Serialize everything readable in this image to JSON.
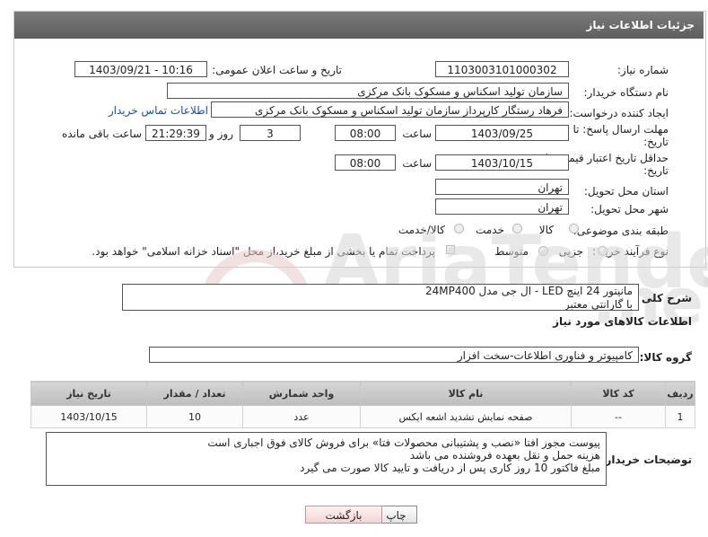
{
  "header": {
    "title": "جزئیات اطلاعات نیاز"
  },
  "form": {
    "need_number_label": "شماره نیاز:",
    "need_number": "1103003101000302",
    "announce_label": "تاریخ و ساعت اعلان عمومی:",
    "announce_value": "1403/09/21 - 10:16",
    "buyer_org_label": "نام دستگاه خریدار:",
    "buyer_org": "سازمان تولید اسکناس و مسکوک بانک مرکزی",
    "creator_label": "ایجاد کننده درخواست:",
    "creator": "فرهاد رستگار کارپرداز سازمان تولید اسکناس و مسکوک بانک مرکزی",
    "contact_link": "اطلاعات تماس خریدار",
    "deadline_label_1": "مهلت ارسال پاسخ: تا",
    "deadline_label_2": "تاریخ:",
    "deadline_date": "1403/09/25",
    "time_label": "ساعت",
    "deadline_time": "08:00",
    "days_value": "3",
    "days_label": "روز و",
    "remaining_time": "21:29:39",
    "remaining_label": "ساعت باقی مانده",
    "price_validity_label_1": "حداقل تاریخ اعتبار قیمت: تا",
    "price_validity_label_2": "تاریخ:",
    "price_validity_date": "1403/10/15",
    "price_validity_time": "08:00",
    "province_label": "استان محل تحویل:",
    "province": "تهران",
    "city_label": "شهر محل تحویل:",
    "city": "تهران",
    "category_label": "طبقه بندی موضوعی:",
    "category_options": [
      "کالا",
      "خدمت",
      "کالا/خدمت"
    ],
    "process_label": "نوع فرآیند خرید :",
    "process_options": [
      "جزیی",
      "متوسط"
    ],
    "payment_note": "پرداخت تمام یا بخشی از مبلغ خرید،از محل \"اسناد خزانه اسلامی\" خواهد بود."
  },
  "description": {
    "label": "شرح کلی نیاز:",
    "line1": "مانیتور 24 اینچ LED - ال جی مدل 24MP400",
    "line2": "با گارانتی معتبر"
  },
  "goods_section": {
    "title": "اطلاعات کالاهای مورد نیاز",
    "group_label": "گروه کالا:",
    "group_value": "کامپیوتر و فناوری اطلاعات-سخت افزار"
  },
  "table": {
    "headers": [
      "ردیف",
      "کد کالا",
      "نام کالا",
      "واحد شمارش",
      "تعداد / مقدار",
      "تاریخ نیاز"
    ],
    "rows": [
      [
        "1",
        "--",
        "صفحه نمایش تشدید اشعه ایکس",
        "عدد",
        "10",
        "1403/10/15"
      ]
    ]
  },
  "buyer_notes": {
    "label": "توضیحات خریدار:",
    "line1": "پیوست مجوز افتا «نصب و پشتیبانی محصولات فتا» برای فروش کالای فوق اجباری است",
    "line2": "هزینه حمل و نقل بعهده فروشنده می باشد",
    "line3": "مبلغ فاکتور 10 روز کاری پس از دریافت و تایید کالا صورت می گیرد"
  },
  "buttons": {
    "print": "چاپ",
    "back": "بازگشت"
  },
  "watermark": {
    "text": "AriaTender.neT"
  }
}
